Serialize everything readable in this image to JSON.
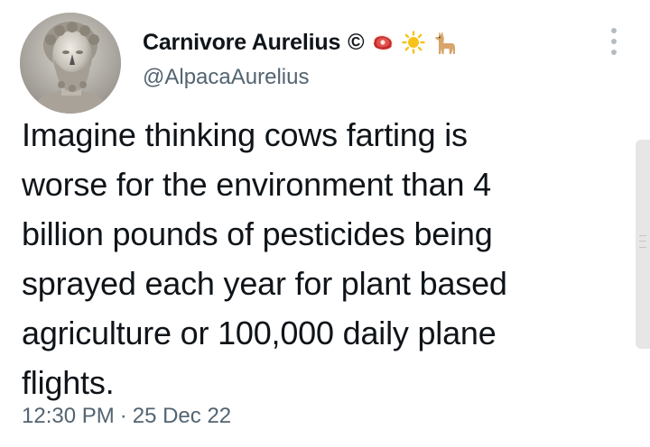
{
  "author": {
    "display_name": "Carnivore Aurelius",
    "copyright_symbol": "©",
    "handle": "@AlpacaAurelius",
    "name_emojis": [
      "steak-emoji",
      "sun-emoji",
      "llama-emoji"
    ]
  },
  "tweet": {
    "lines": [
      "Imagine thinking cows farting is",
      "worse for the environment than 4",
      "billion pounds of pesticides being",
      "sprayed each year for plant based",
      "agriculture or 100,000 daily plane",
      "flights."
    ],
    "time": "12:30 PM",
    "separator": "·",
    "date": "25 Dec 22"
  },
  "colors": {
    "text": "#0f1419",
    "secondary": "#536471",
    "background": "#ffffff"
  }
}
